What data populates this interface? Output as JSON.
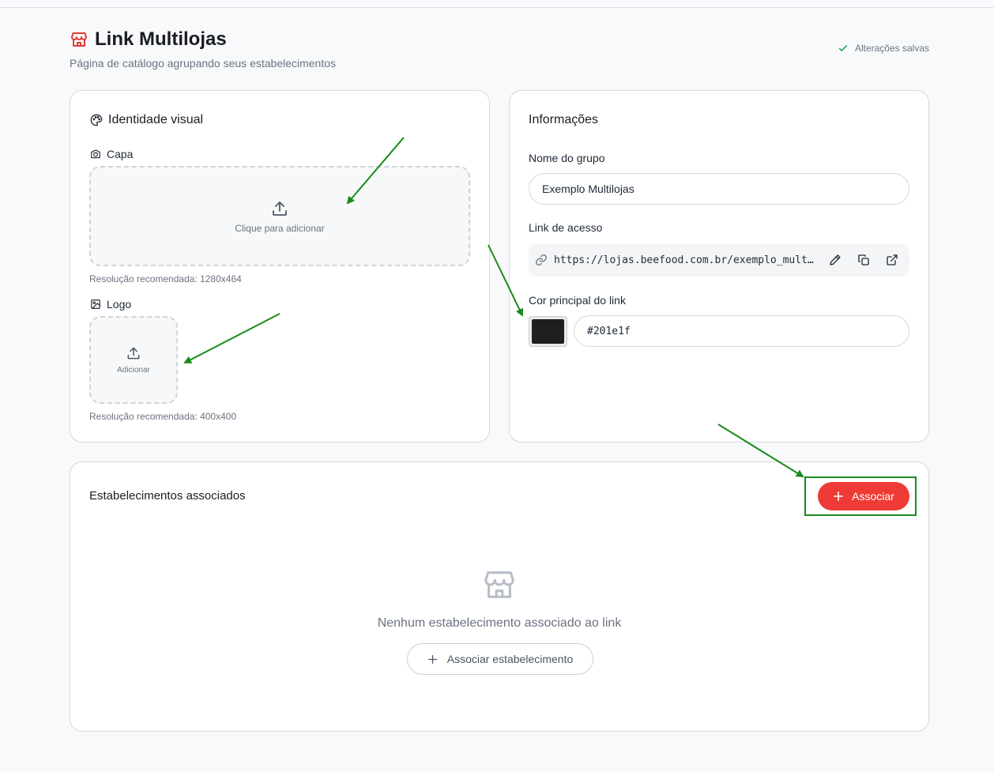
{
  "header": {
    "title": "Link Multilojas",
    "subtitle": "Página de catálogo agrupando seus estabelecimentos",
    "saved_status": "Alterações salvas",
    "icon": "store-icon"
  },
  "visual_identity": {
    "title": "Identidade visual",
    "cover": {
      "label": "Capa",
      "upload_text": "Clique para adicionar",
      "hint": "Resolução recomendada: 1280x464"
    },
    "logo": {
      "label": "Logo",
      "upload_text": "Adicionar",
      "hint": "Resolução recomendada: 400x400"
    }
  },
  "info": {
    "title": "Informações",
    "group_name_label": "Nome do grupo",
    "group_name_value": "Exemplo Multilojas",
    "access_link_label": "Link de acesso",
    "access_link_value": "https://lojas.beefood.com.br/exemplo_multilojas",
    "color_label": "Cor principal do link",
    "color_value": "#201e1f"
  },
  "establishments": {
    "title": "Estabelecimentos associados",
    "associate_button": "Associar",
    "empty_message": "Nenhum estabelecimento associado ao link",
    "associate_establishment_button": "Associar estabelecimento"
  },
  "colors": {
    "accent_red": "#ef3b36",
    "annotation_green": "#1a8a1a"
  }
}
